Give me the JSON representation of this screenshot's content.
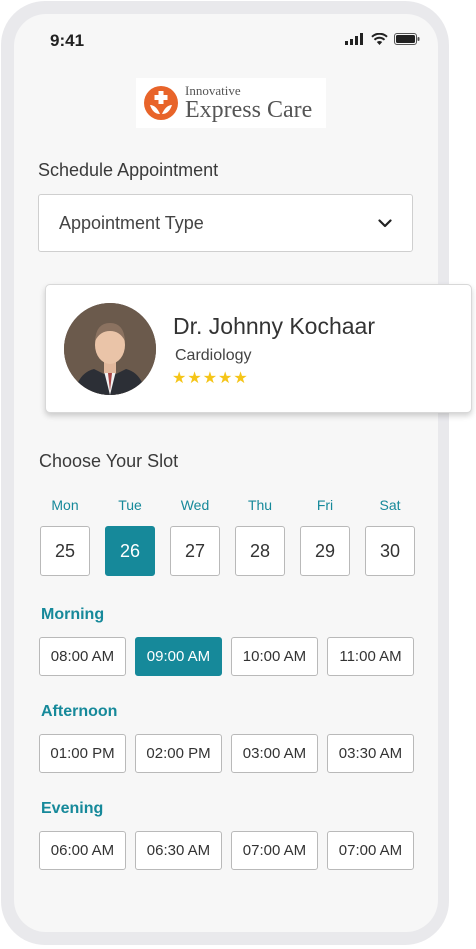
{
  "status": {
    "time": "9:41"
  },
  "logo": {
    "line1": "Innovative",
    "line2": "Express Care"
  },
  "schedule_title": "Schedule Appointment",
  "appointment_select": {
    "label": "Appointment Type"
  },
  "doctor": {
    "name": "Dr. Johnny Kochaar",
    "specialty": "Cardiology",
    "rating": 5,
    "stars": "★★★★★"
  },
  "slot_title": "Choose Your Slot",
  "days": [
    {
      "day": "Mon",
      "date": "25"
    },
    {
      "day": "Tue",
      "date": "26"
    },
    {
      "day": "Wed",
      "date": "27"
    },
    {
      "day": "Thu",
      "date": "28"
    },
    {
      "day": "Fri",
      "date": "29"
    },
    {
      "day": "Sat",
      "date": "30"
    }
  ],
  "selected_date": "26",
  "periods": [
    {
      "label": "Morning",
      "slots": [
        "08:00 AM",
        "09:00 AM",
        "10:00 AM",
        "11:00 AM"
      ]
    },
    {
      "label": "Afternoon",
      "slots": [
        "01:00 PM",
        "02:00 PM",
        "03:00 AM",
        "03:30 AM"
      ]
    },
    {
      "label": "Evening",
      "slots": [
        "06:00 AM",
        "06:30 AM",
        "07:00 AM",
        "07:00 AM"
      ]
    }
  ],
  "selected_slot": "09:00 AM",
  "colors": {
    "accent": "#16899a",
    "star": "#f5c518",
    "logo": "#e8642a"
  }
}
